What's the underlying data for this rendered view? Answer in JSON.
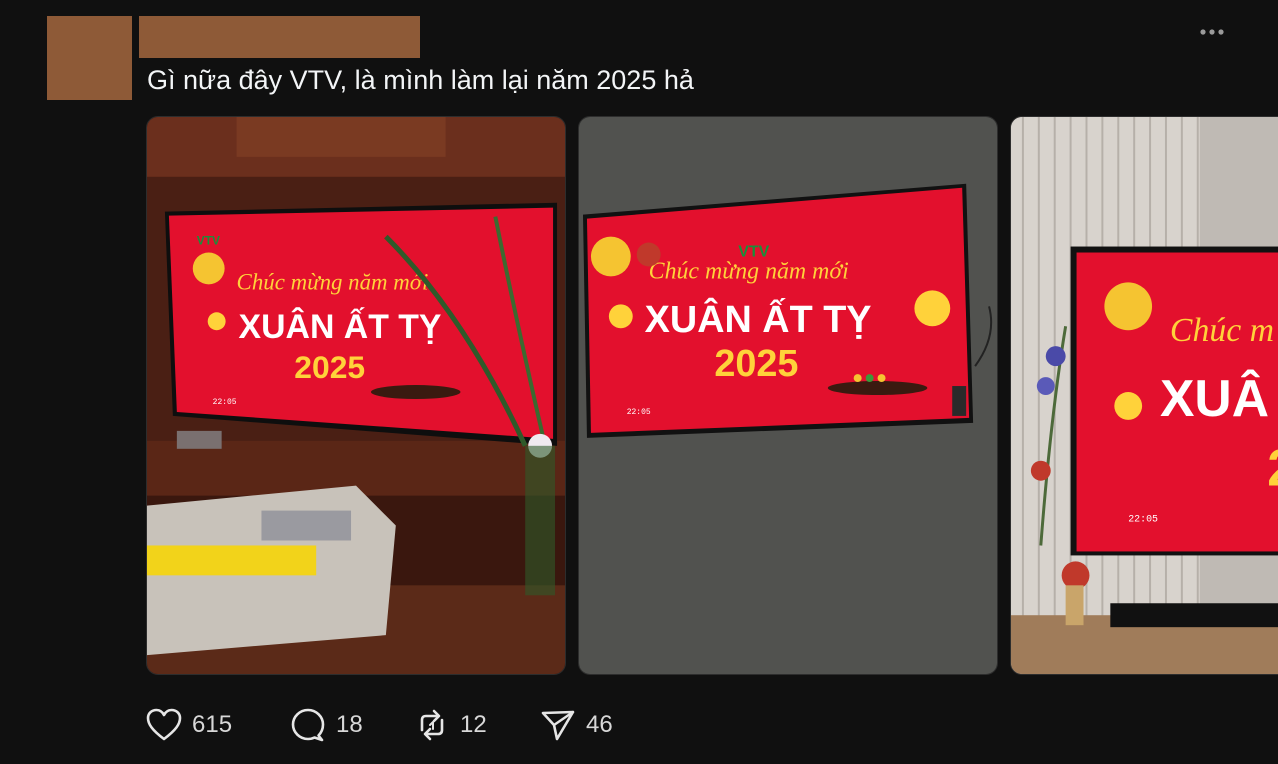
{
  "post": {
    "text": "Gì nữa đây VTV, là mình làm lại năm 2025 hả",
    "avatar_redacted_color": "#8e5a37",
    "more_icon": "more-horizontal-icon"
  },
  "tv_screen": {
    "logo": "VTV",
    "greeting": "Chúc mừng năm mới",
    "headline": "XUÂN ẤT TỴ",
    "year": "2025",
    "clock": "22:05",
    "partial_greeting": "Chúc m",
    "partial_headline": "XUÂ",
    "partial_year": "2"
  },
  "actions": {
    "likes": "615",
    "comments": "18",
    "reposts": "12",
    "shares": "46"
  },
  "colors": {
    "background": "#101010",
    "tv_red": "#e3102d",
    "gold": "#ffd23a"
  }
}
